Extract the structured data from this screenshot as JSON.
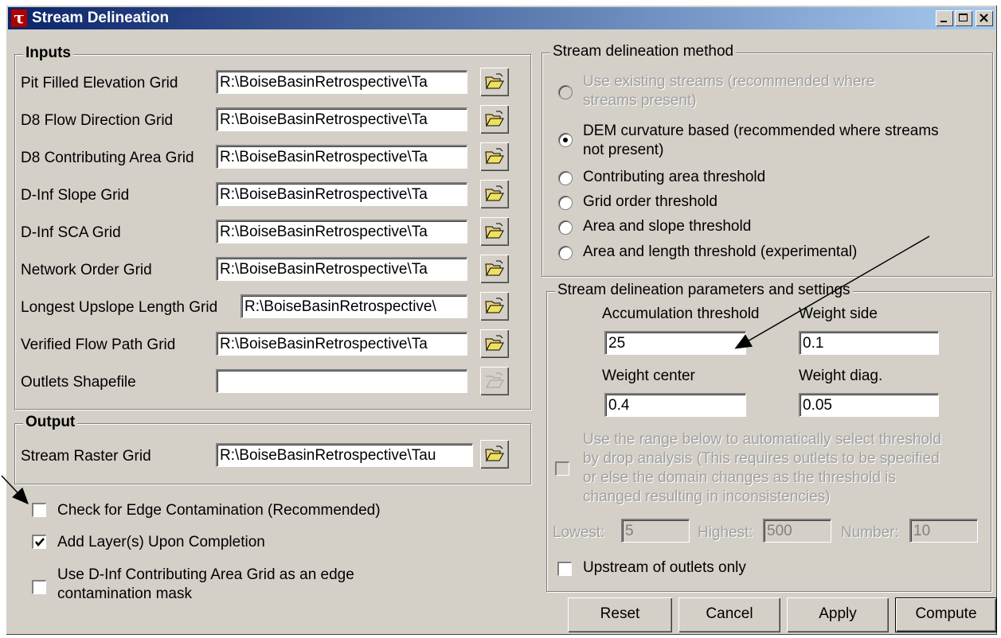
{
  "window": {
    "title": "Stream Delineation",
    "icon_glyph": "τ",
    "controls": [
      "minimize-icon",
      "maximize-icon",
      "close-icon"
    ]
  },
  "inputs": {
    "title": "Inputs",
    "rows": [
      {
        "label": "Pit Filled Elevation Grid",
        "value": "R:\\BoiseBasinRetrospective\\Ta"
      },
      {
        "label": "D8 Flow Direction Grid",
        "value": "R:\\BoiseBasinRetrospective\\Ta"
      },
      {
        "label": "D8 Contributing Area Grid",
        "value": "R:\\BoiseBasinRetrospective\\Ta"
      },
      {
        "label": "D-Inf Slope Grid",
        "value": "R:\\BoiseBasinRetrospective\\Ta"
      },
      {
        "label": "D-Inf SCA  Grid",
        "value": "R:\\BoiseBasinRetrospective\\Ta"
      },
      {
        "label": "Network Order Grid",
        "value": "R:\\BoiseBasinRetrospective\\Ta"
      },
      {
        "label": "Longest Upslope Length Grid",
        "value": "R:\\BoiseBasinRetrospective\\"
      },
      {
        "label": "Verified Flow Path Grid",
        "value": "R:\\BoiseBasinRetrospective\\Ta"
      },
      {
        "label": "Outlets Shapefile",
        "value": ""
      }
    ]
  },
  "output": {
    "title": "Output",
    "label": "Stream Raster Grid",
    "value": "R:\\BoiseBasinRetrospective\\Tau"
  },
  "options": {
    "edge": {
      "label": "Check for Edge Contamination (Recommended)",
      "checked": false
    },
    "add_layers": {
      "label": "Add Layer(s) Upon Completion",
      "checked": true
    },
    "dinf_mask": {
      "line1": "Use D-Inf Contributing Area Grid as an edge",
      "line2": "contamination mask",
      "checked": false
    }
  },
  "method": {
    "title": "Stream delineation method",
    "existing": {
      "line1": "Use existing streams (recommended where",
      "line2": "streams present)"
    },
    "curvature": {
      "line1": "DEM curvature based (recommended where streams",
      "line2": "not present)"
    },
    "contrib": "Contributing area threshold",
    "grid_order": "Grid order threshold",
    "area_slope": "Area and slope threshold",
    "area_length": "Area and length threshold (experimental)",
    "selected": "curvature"
  },
  "params": {
    "title": "Stream delineation parameters and settings",
    "accum_label": "Accumulation threshold",
    "accum_value": "25",
    "wside_label": "Weight side",
    "wside_value": "0.1",
    "wcenter_label": "Weight center",
    "wcenter_value": "0.4",
    "wdiag_label": "Weight diag.",
    "wdiag_value": "0.05",
    "drop": {
      "line1": "Use the range below to automatically select threshold",
      "line2": "by drop analysis (This requires outlets to be specified",
      "line3": "or else the domain changes as the threshold is",
      "line4": "changed resulting in inconsistencies)"
    },
    "lowest_label": "Lowest:",
    "lowest_value": "5",
    "highest_label": "Highest:",
    "highest_value": "500",
    "number_label": "Number:",
    "number_value": "10",
    "upstream_label": "Upstream of outlets only"
  },
  "buttons": {
    "reset": "Reset",
    "cancel": "Cancel",
    "apply": "Apply",
    "compute": "Compute"
  },
  "colors": {
    "title_start": "#0a246a",
    "title_end": "#a6caf0",
    "face": "#d4d0c8",
    "icon": "#b00000"
  }
}
